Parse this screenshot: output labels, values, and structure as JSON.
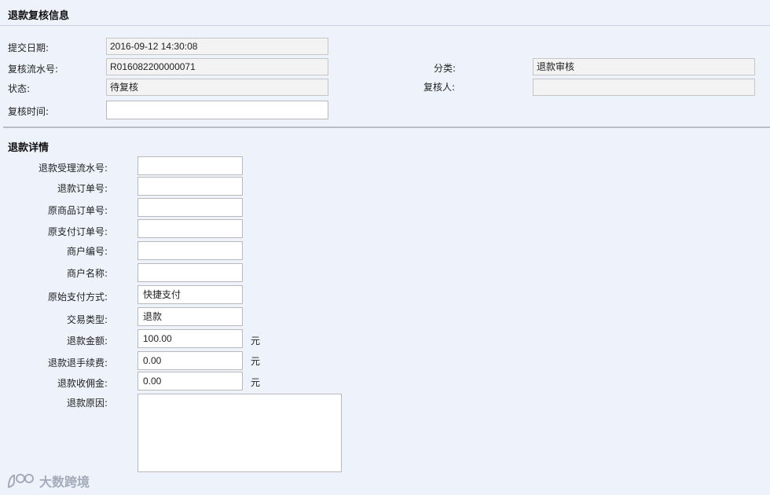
{
  "header": {
    "title": "退款复核信息"
  },
  "review": {
    "submit_date_label": "提交日期:",
    "submit_date_value": "2016-09-12 14:30:08",
    "serial_label": "复核流水号:",
    "serial_value": "R016082200000071",
    "category_label": "分类:",
    "category_value": "退款审核",
    "status_label": "状态:",
    "status_value": "待复核",
    "reviewer_label": "复核人:",
    "reviewer_value": "",
    "review_time_label": "复核时间:",
    "review_time_value": ""
  },
  "details": {
    "title": "退款详情",
    "fields": [
      {
        "label": "退款受理流水号:",
        "value": ""
      },
      {
        "label": "退款订单号:",
        "value": ""
      },
      {
        "label": "原商品订单号:",
        "value": ""
      },
      {
        "label": "原支付订单号:",
        "value": ""
      },
      {
        "label": "商户编号:",
        "value": ""
      },
      {
        "label": "商户名称:",
        "value": ""
      },
      {
        "label": "原始支付方式:",
        "value": "快捷支付"
      },
      {
        "label": "交易类型:",
        "value": "退款"
      },
      {
        "label": "退款金额:",
        "value": "100.00",
        "unit": "元"
      },
      {
        "label": "退款退手续费:",
        "value": "0.00",
        "unit": "元"
      },
      {
        "label": "退款收佣金:",
        "value": "0.00",
        "unit": "元"
      }
    ],
    "reason_label": "退款原因:",
    "reason_value": ""
  },
  "watermark": {
    "text": "大数跨境"
  }
}
